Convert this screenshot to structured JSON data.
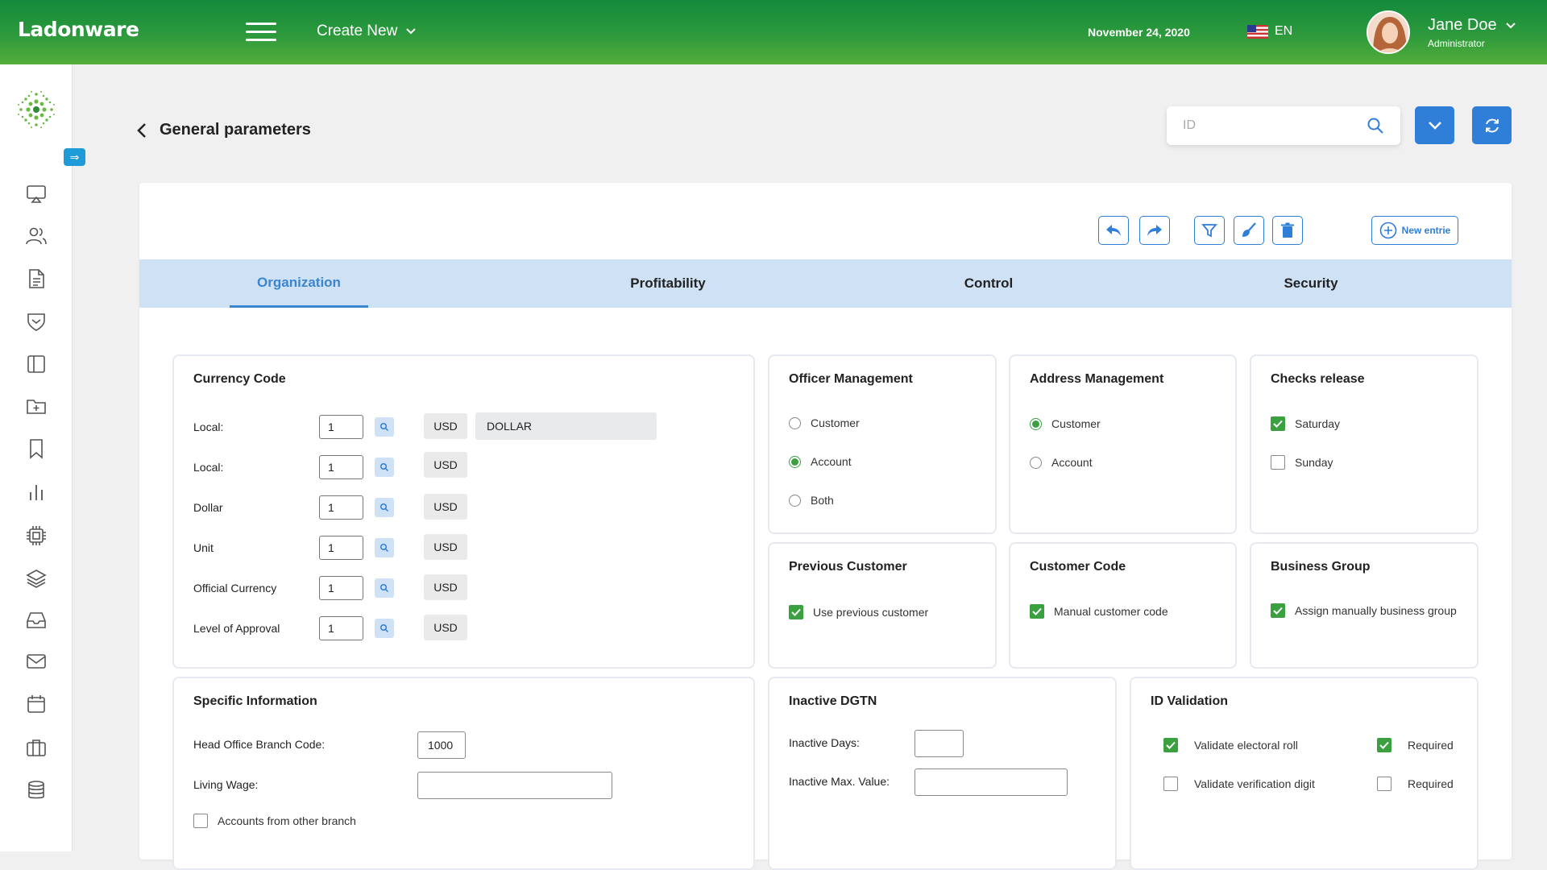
{
  "topbar": {
    "logo": "Ladonware",
    "create_new": "Create New",
    "date": "November 24, 2020",
    "language": "EN",
    "user_name": "Jane Doe",
    "user_role": "Administrator",
    "brand_color": "#2d9a3c"
  },
  "sidebar": {
    "icons": [
      "presentation-icon",
      "users-icon",
      "document-icon",
      "shield-icon",
      "columns-icon",
      "folder-plus-icon",
      "bookmark-icon",
      "bar-chart-icon",
      "cpu-icon",
      "layers-icon",
      "inbox-icon",
      "mail-icon",
      "calendar-icon",
      "briefcase-icon",
      "database-icon"
    ]
  },
  "page": {
    "title": "General parameters",
    "search_placeholder": "ID",
    "new_entry": "New entrie"
  },
  "tabs": [
    {
      "label": "Organization",
      "active": true
    },
    {
      "label": "Profitability",
      "active": false
    },
    {
      "label": "Control",
      "active": false
    },
    {
      "label": "Security",
      "active": false
    }
  ],
  "currency": {
    "title": "Currency Code",
    "rows": [
      {
        "label": "Local:",
        "value": "1",
        "code": "USD",
        "description": "DOLLAR"
      },
      {
        "label": "Local:",
        "value": "1",
        "code": "USD"
      },
      {
        "label": "Dollar",
        "value": "1",
        "code": "USD"
      },
      {
        "label": "Unit",
        "value": "1",
        "code": "USD"
      },
      {
        "label": "Official Currency",
        "value": "1",
        "code": "USD"
      },
      {
        "label": "Level of Approval",
        "value": "1",
        "code": "USD"
      }
    ]
  },
  "officer": {
    "title": "Officer Management",
    "options": [
      {
        "label": "Customer",
        "selected": false
      },
      {
        "label": "Account",
        "selected": true
      },
      {
        "label": "Both",
        "selected": false
      }
    ]
  },
  "address": {
    "title": "Address Management",
    "options": [
      {
        "label": "Customer",
        "selected": true
      },
      {
        "label": "Account",
        "selected": false
      }
    ]
  },
  "checks": {
    "title": "Checks release",
    "options": [
      {
        "label": "Saturday",
        "checked": true
      },
      {
        "label": "Sunday",
        "checked": false
      }
    ]
  },
  "previous_customer": {
    "title": "Previous Customer",
    "option": "Use previous customer",
    "checked": true
  },
  "customer_code": {
    "title": "Customer Code",
    "option": "Manual customer code",
    "checked": true
  },
  "business_group": {
    "title": "Business Group",
    "option": "Assign manually business group",
    "checked": true
  },
  "specific": {
    "title": "Specific Information",
    "head_office_label": "Head Office Branch Code:",
    "head_office_value": "1000",
    "living_wage_label": "Living Wage:",
    "living_wage_value": "",
    "other_branch_label": "Accounts from other branch",
    "other_branch_checked": false
  },
  "inactive": {
    "title": "Inactive DGTN",
    "days_label": "Inactive Days:",
    "days_value": "",
    "max_label": "Inactive Max. Value:",
    "max_value": ""
  },
  "id_validation": {
    "title": "ID Validation",
    "rows": [
      {
        "label": "Validate electoral roll",
        "checked": true,
        "required_label": "Required",
        "required": true
      },
      {
        "label": "Validate verification digit",
        "checked": false,
        "required_label": "Required",
        "required": false
      }
    ]
  }
}
